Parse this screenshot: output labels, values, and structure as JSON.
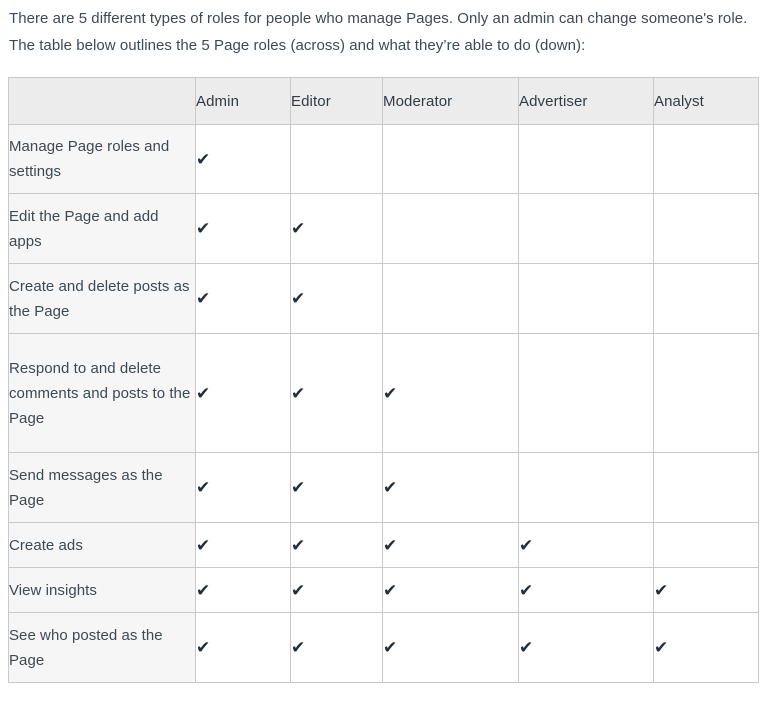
{
  "intro": {
    "paragraph": "There are 5 different types of roles for people who manage Pages. Only an admin can change someone's role. The table below outlines the 5 Page roles (across) and what they’re able to do (down):"
  },
  "table": {
    "corner_label": "",
    "columns": [
      "Admin",
      "Editor",
      "Moderator",
      "Advertiser",
      "Analyst"
    ],
    "check_glyph": "✔",
    "rows": [
      {
        "task": "Manage Page roles and settings",
        "values": [
          true,
          false,
          false,
          false,
          false
        ]
      },
      {
        "task": "Edit the Page and add apps",
        "values": [
          true,
          true,
          false,
          false,
          false
        ]
      },
      {
        "task": "Create and delete posts as the Page",
        "values": [
          true,
          true,
          false,
          false,
          false
        ]
      },
      {
        "task": "Respond to and delete comments and posts to the Page",
        "values": [
          true,
          true,
          true,
          false,
          false
        ]
      },
      {
        "task": "Send messages as the Page",
        "values": [
          true,
          true,
          true,
          false,
          false
        ]
      },
      {
        "task": "Create ads",
        "values": [
          true,
          true,
          true,
          true,
          false
        ]
      },
      {
        "task": "View insights",
        "values": [
          true,
          true,
          true,
          true,
          true
        ]
      },
      {
        "task": "See who posted as the Page",
        "values": [
          true,
          true,
          true,
          true,
          true
        ]
      }
    ]
  },
  "colors": {
    "text": "#3c4a55",
    "header_bg": "#ececec",
    "task_bg": "#f6f6f6",
    "cell_bg": "#ffffff",
    "outer_border": "#8a8a8a",
    "inner_border": "#c9c9c9",
    "check": "#242e37"
  }
}
